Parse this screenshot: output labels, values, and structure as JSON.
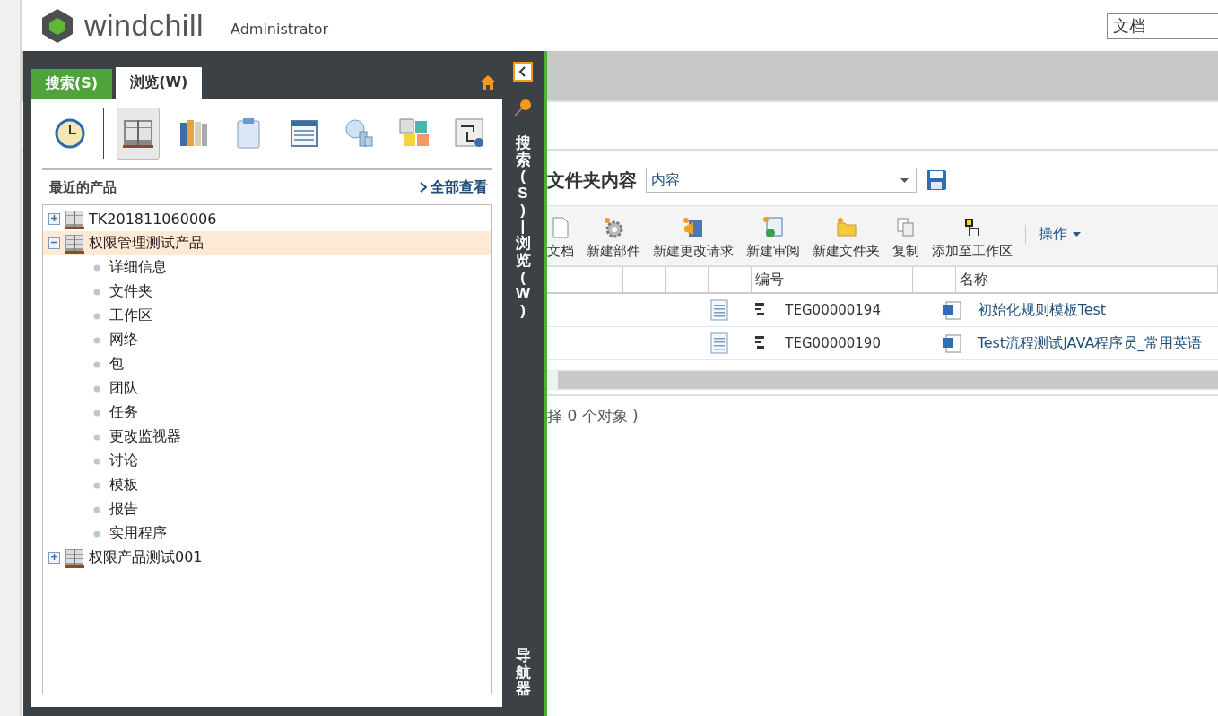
{
  "header": {
    "logo": "windchill",
    "user": "Administrator",
    "search": {
      "value": "文档"
    }
  },
  "navigator": {
    "tabs": [
      {
        "label": "搜索(S)",
        "selected": false
      },
      {
        "label": "浏览(W)",
        "selected": true
      }
    ],
    "side_label": "搜索(S) | 浏览(W)",
    "side_title": "导航器",
    "tools": [
      {
        "kind": "clock",
        "selected": false
      },
      {
        "kind": "products",
        "selected": true
      },
      {
        "kind": "libraries",
        "selected": false
      },
      {
        "kind": "clipboard",
        "selected": false
      },
      {
        "kind": "table",
        "selected": false
      },
      {
        "kind": "shapes",
        "selected": false
      },
      {
        "kind": "tiles",
        "selected": false
      },
      {
        "kind": "diagram",
        "selected": false
      }
    ],
    "section": {
      "title": "最近的产品",
      "link": "全部查看"
    },
    "tree": [
      {
        "label": "TK201811060006",
        "expanded": false,
        "selected": false
      },
      {
        "label": "权限管理测试产品",
        "expanded": true,
        "selected": true,
        "children": [
          {
            "label": "详细信息"
          },
          {
            "label": "文件夹"
          },
          {
            "label": "工作区"
          },
          {
            "label": "网络"
          },
          {
            "label": "包"
          },
          {
            "label": "团队"
          },
          {
            "label": "任务"
          },
          {
            "label": "更改监视器"
          },
          {
            "label": "讨论"
          },
          {
            "label": "模板"
          },
          {
            "label": "报告"
          },
          {
            "label": "实用程序"
          }
        ]
      },
      {
        "label": "权限产品测试001",
        "expanded": false,
        "selected": false
      }
    ]
  },
  "folder": {
    "title": "文件夹内容",
    "view": "内容"
  },
  "toolbar": [
    {
      "label": "文档",
      "kind": "document"
    },
    {
      "label": "新建部件",
      "kind": "gear"
    },
    {
      "label": "新建更改请求",
      "kind": "change"
    },
    {
      "label": "新建审阅",
      "kind": "review"
    },
    {
      "label": "新建文件夹",
      "kind": "folder"
    },
    {
      "label": "复制",
      "kind": "copy"
    },
    {
      "label": "添加至工作区",
      "kind": "workspace"
    },
    {
      "label": "操作",
      "kind": "menu"
    }
  ],
  "table": {
    "columns": [
      "编号",
      "名称"
    ],
    "rows": [
      {
        "number": "TEG00000194",
        "name": "初始化规则模板Test"
      },
      {
        "number": "TEG00000190",
        "name": "Test流程测试JAVA程序员_常用英语"
      }
    ]
  },
  "status": "择 0 个对象 )"
}
